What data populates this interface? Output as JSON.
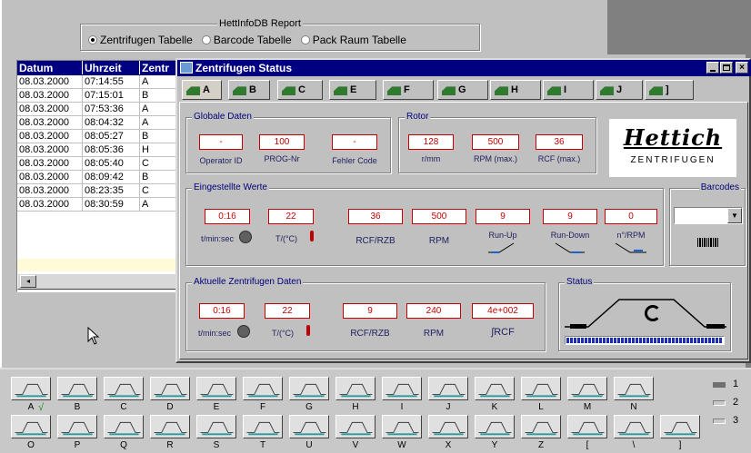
{
  "report": {
    "title": "HettInfoDB  Report",
    "options": [
      {
        "label": "Zentrifugen Tabelle",
        "selected": true
      },
      {
        "label": "Barcode Tabelle",
        "selected": false
      },
      {
        "label": "Pack Raum Tabelle",
        "selected": false
      }
    ]
  },
  "table": {
    "headers": [
      "Datum",
      "Uhrzeit",
      "Zentr"
    ],
    "rows": [
      [
        "08.03.2000",
        "07:14:55",
        "A"
      ],
      [
        "08.03.2000",
        "07:15:01",
        "B"
      ],
      [
        "08.03.2000",
        "07:53:36",
        "A"
      ],
      [
        "08.03.2000",
        "08:04:32",
        "A"
      ],
      [
        "08.03.2000",
        "08:05:27",
        "B"
      ],
      [
        "08.03.2000",
        "08:05:36",
        "H"
      ],
      [
        "08.03.2000",
        "08:05:40",
        "C"
      ],
      [
        "08.03.2000",
        "08:09:42",
        "B"
      ],
      [
        "08.03.2000",
        "08:23:35",
        "C"
      ],
      [
        "08.03.2000",
        "08:30:59",
        "A"
      ]
    ]
  },
  "status_window": {
    "title": "Zentrifugen Status",
    "tabs": [
      "A",
      "B",
      "C",
      "E",
      "F",
      "G",
      "H",
      "I",
      "J",
      "]"
    ],
    "globale": {
      "title": "Globale Daten",
      "operator_id": {
        "value": "-",
        "label": "Operator ID"
      },
      "prog_nr": {
        "value": "100",
        "label": "PROG-Nr"
      },
      "fehler_code": {
        "value": "-",
        "label": "Fehler Code"
      }
    },
    "rotor": {
      "title": "Rotor",
      "rmm": {
        "value": "128",
        "label": "r/mm"
      },
      "rpm_max": {
        "value": "500",
        "label": "RPM (max.)"
      },
      "rcf_max": {
        "value": "36",
        "label": "RCF (max.)"
      }
    },
    "logo": {
      "brand": "Hettich",
      "sub": "ZENTRIFUGEN"
    },
    "eingestellte": {
      "title": "Eingestellte  Werte",
      "time": {
        "value": "0:16",
        "label": "t/min:sec"
      },
      "temp": {
        "value": "22",
        "label": "T/(°C)"
      },
      "rcf": {
        "value": "36",
        "label": "RCF/RZB"
      },
      "rpm": {
        "value": "500",
        "label": "RPM"
      },
      "runup": {
        "value": "9",
        "label": "Run-Up"
      },
      "rundown": {
        "value": "9",
        "label": "Run-Down"
      },
      "n_rpm": {
        "value": "0",
        "label": "n°/RPM"
      }
    },
    "barcodes": {
      "title": "Barcodes"
    },
    "aktuelle": {
      "title": "Aktuelle Zentrifugen Daten",
      "time": {
        "value": "0:16",
        "label": "t/min:sec"
      },
      "temp": {
        "value": "22",
        "label": "T/(°C)"
      },
      "rcf": {
        "value": "9",
        "label": "RCF/RZB"
      },
      "rpm": {
        "value": "240",
        "label": "RPM"
      },
      "integral": {
        "value": "4e+002",
        "label": "∫RCF"
      }
    },
    "status": {
      "title": "Status"
    }
  },
  "panel": {
    "row1_labels": [
      "A",
      "B",
      "C",
      "D",
      "E",
      "F",
      "G",
      "H",
      "I",
      "J",
      "K",
      "L",
      "M",
      "N"
    ],
    "row2_labels": [
      "O",
      "P",
      "Q",
      "R",
      "S",
      "T",
      "U",
      "V",
      "W",
      "X",
      "Y",
      "Z",
      "[",
      "\\",
      "]"
    ],
    "row1_check": "√",
    "side_numbers": [
      "1",
      "2",
      "3"
    ]
  },
  "colors": {
    "title_bar": "#000080",
    "value_red": "#c00000",
    "progress_blue": "#1c2fb0"
  }
}
